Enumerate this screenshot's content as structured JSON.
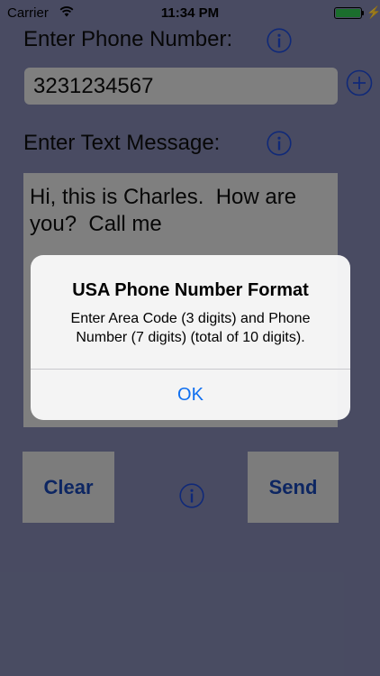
{
  "status_bar": {
    "carrier": "Carrier",
    "time": "11:34 PM",
    "battery_color": "#2eb84b"
  },
  "form": {
    "phone_label": "Enter Phone Number:",
    "phone_value": "3231234567",
    "message_label": "Enter Text Message:",
    "message_value": "Hi, this is Charles.  How are\nyou?  Call me"
  },
  "buttons": {
    "clear": "Clear",
    "send": "Send"
  },
  "icons": {
    "info": "info-icon",
    "add": "plus-icon",
    "wifi": "wifi-icon",
    "battery": "battery-icon"
  },
  "alert": {
    "title": "USA Phone Number Format",
    "message": "Enter Area Code (3 digits) and Phone Number (7 digits) (total of 10 digits).",
    "ok": "OK"
  },
  "colors": {
    "background": "#7a7ea4",
    "button_text": "#1640a3",
    "icon_blue": "#1b45c9",
    "alert_button": "#0f6ff0"
  }
}
